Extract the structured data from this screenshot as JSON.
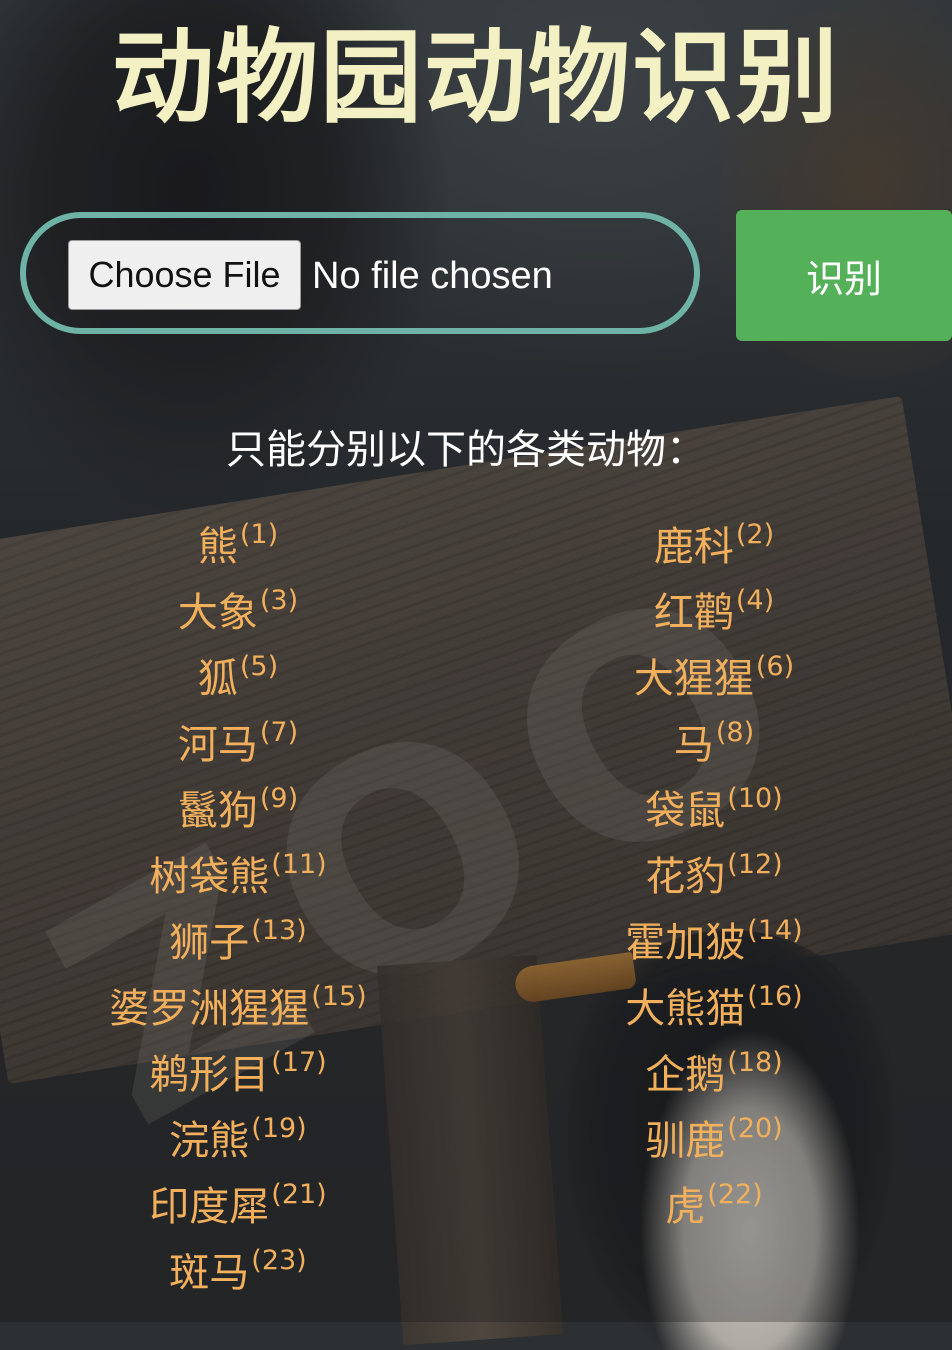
{
  "title": "动物园动物识别",
  "upload": {
    "choose_file_label": "Choose File",
    "file_status": "No file chosen"
  },
  "identify_button_label": "识别",
  "instruction": "只能分别以下的各类动物：",
  "animals": [
    {
      "name": "熊",
      "num": "(1)"
    },
    {
      "name": "鹿科",
      "num": "(2)"
    },
    {
      "name": "大象",
      "num": "(3)"
    },
    {
      "name": "红鹳",
      "num": "(4)"
    },
    {
      "name": "狐",
      "num": "(5)"
    },
    {
      "name": "大猩猩",
      "num": "(6)"
    },
    {
      "name": "河马",
      "num": "(7)"
    },
    {
      "name": "马",
      "num": "(8)"
    },
    {
      "name": "鬣狗",
      "num": "(9)"
    },
    {
      "name": "袋鼠",
      "num": "(10)"
    },
    {
      "name": "树袋熊",
      "num": "(11)"
    },
    {
      "name": "花豹",
      "num": "(12)"
    },
    {
      "name": "狮子",
      "num": "(13)"
    },
    {
      "name": "霍加狓",
      "num": "(14)"
    },
    {
      "name": "婆罗洲猩猩",
      "num": "(15)"
    },
    {
      "name": "大熊猫",
      "num": "(16)"
    },
    {
      "name": "鹈形目",
      "num": "(17)"
    },
    {
      "name": "企鹅",
      "num": "(18)"
    },
    {
      "name": "浣熊",
      "num": "(19)"
    },
    {
      "name": "驯鹿",
      "num": "(20)"
    },
    {
      "name": "印度犀",
      "num": "(21)"
    },
    {
      "name": "虎",
      "num": "(22)"
    },
    {
      "name": "斑马",
      "num": "(23)"
    }
  ],
  "colors": {
    "title": "#f3f1c3",
    "upload_border": "#6fb3a6",
    "identify_button": "#55b05a",
    "animal_text": "#f2b05c"
  }
}
